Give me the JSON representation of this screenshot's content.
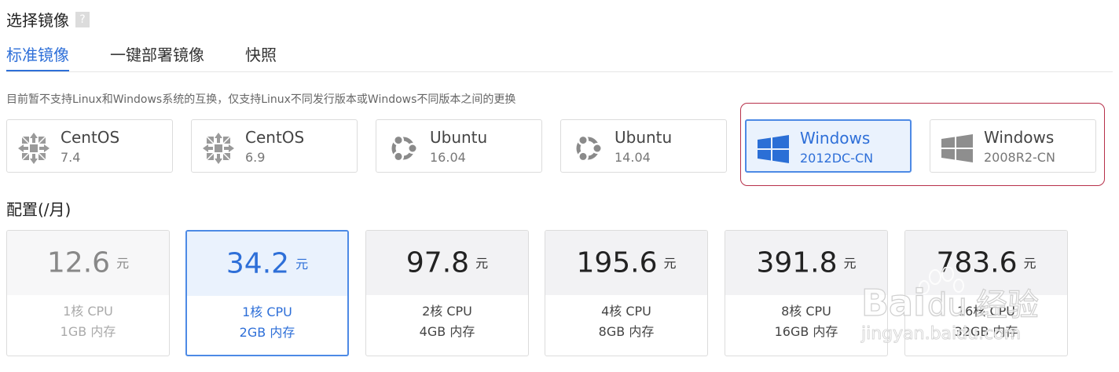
{
  "section_title": "选择镜像",
  "help_glyph": "?",
  "tabs": [
    {
      "label": "标准镜像",
      "active": true
    },
    {
      "label": "一键部署镜像",
      "active": false
    },
    {
      "label": "快照",
      "active": false
    }
  ],
  "note": "目前暂不支持Linux和Windows系统的互换，仅支持Linux不同发行版本或Windows不同版本之间的更换",
  "images": [
    {
      "name": "CentOS",
      "version": "7.4",
      "icon": "centos-icon"
    },
    {
      "name": "CentOS",
      "version": "6.9",
      "icon": "centos-icon"
    },
    {
      "name": "Ubuntu",
      "version": "16.04",
      "icon": "ubuntu-icon"
    },
    {
      "name": "Ubuntu",
      "version": "14.04",
      "icon": "ubuntu-icon"
    },
    {
      "name": "Windows",
      "version": "2012DC-CN",
      "icon": "windows-icon",
      "selected": true
    },
    {
      "name": "Windows",
      "version": "2008R2-CN",
      "icon": "windows-icon"
    }
  ],
  "config_title": "配置(/月)",
  "configs": [
    {
      "price": "12.6",
      "unit": "元",
      "cpu": "1核 CPU",
      "mem": "1GB 内存",
      "state": "disabled"
    },
    {
      "price": "34.2",
      "unit": "元",
      "cpu": "1核 CPU",
      "mem": "2GB 内存",
      "state": "selected"
    },
    {
      "price": "97.8",
      "unit": "元",
      "cpu": "2核 CPU",
      "mem": "4GB 内存",
      "state": "normal"
    },
    {
      "price": "195.6",
      "unit": "元",
      "cpu": "4核 CPU",
      "mem": "8GB 内存",
      "state": "normal"
    },
    {
      "price": "391.8",
      "unit": "元",
      "cpu": "8核 CPU",
      "mem": "16GB 内存",
      "state": "normal"
    },
    {
      "price": "783.6",
      "unit": "元",
      "cpu": "16核 CPU",
      "mem": "32GB 内存",
      "state": "normal"
    }
  ],
  "colors": {
    "accent": "#2e6fd8",
    "selected_bg": "#eaf2fd",
    "highlight_box": "#b7304a",
    "windows_active": "#2b6fd6",
    "windows_inactive": "#8e8e8e"
  },
  "watermark": {
    "line1": "Bai",
    "line2": "经验",
    "line3": "jingyan.baidu.com"
  }
}
